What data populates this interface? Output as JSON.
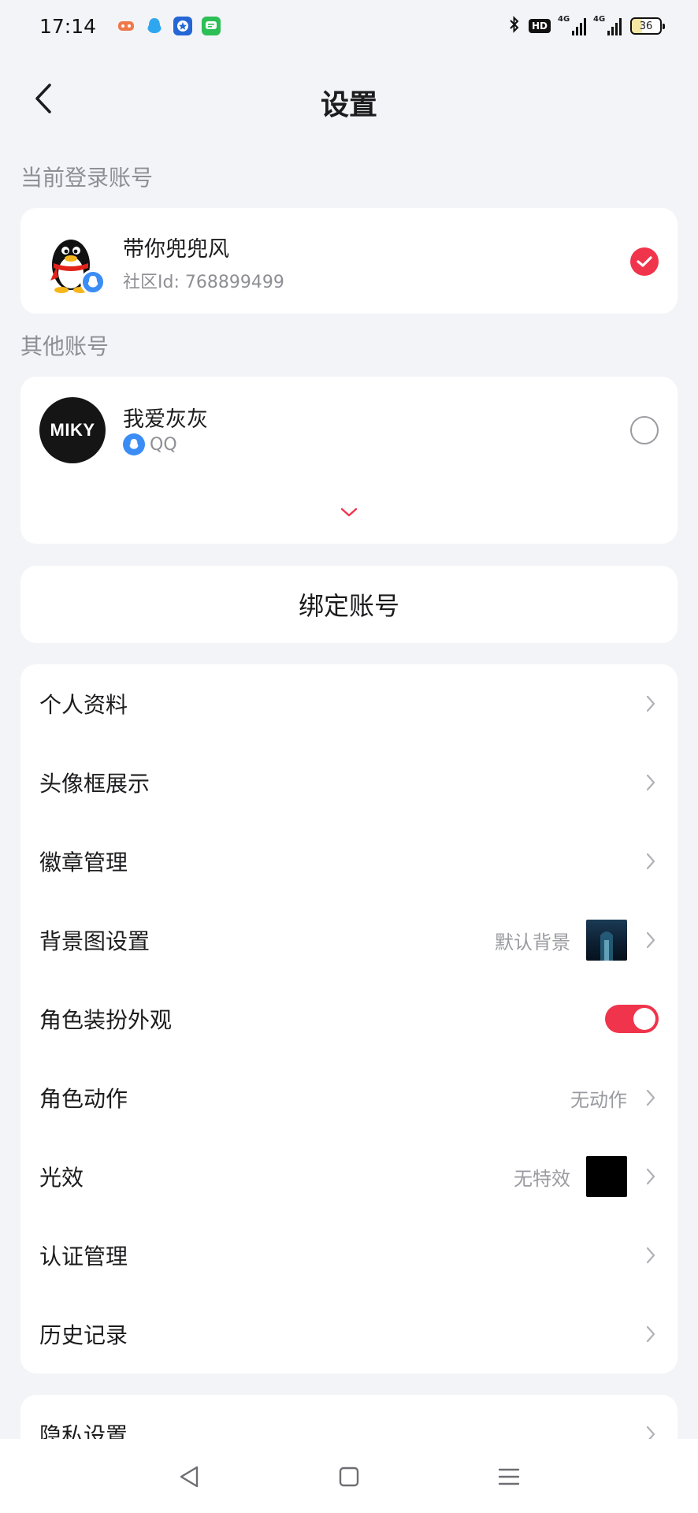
{
  "status_bar": {
    "time": "17:14",
    "hd_label": "HD",
    "signal1_label": "4G",
    "signal2_label": "4G",
    "battery_level": "36",
    "notification_icons": [
      "game-app-icon",
      "qq-app-icon",
      "star-app-icon",
      "message-app-icon"
    ]
  },
  "header": {
    "title": "设置"
  },
  "current_account": {
    "section_label": "当前登录账号",
    "name": "带你兜兜风",
    "id_text": "社区Id: 768899499",
    "selected": true
  },
  "other_accounts": {
    "section_label": "其他账号",
    "items": [
      {
        "name": "我爱灰灰",
        "platform": "QQ",
        "avatar_text": "MIKY",
        "selected": false
      }
    ]
  },
  "bind_button": {
    "label": "绑定账号"
  },
  "menu": {
    "items": [
      {
        "label": "个人资料"
      },
      {
        "label": "头像框展示"
      },
      {
        "label": "徽章管理"
      },
      {
        "label": "背景图设置",
        "value": "默认背景"
      },
      {
        "label": "角色装扮外观",
        "toggle_on": true
      },
      {
        "label": "角色动作",
        "value": "无动作"
      },
      {
        "label": "光效",
        "value": "无特效"
      },
      {
        "label": "认证管理"
      },
      {
        "label": "历史记录"
      }
    ]
  },
  "menu2": {
    "items": [
      {
        "label": "隐私设置"
      }
    ]
  },
  "colors": {
    "accent": "#f0344c",
    "background": "#f3f4f8",
    "card": "#ffffff",
    "secondary_text": "#8e8f94"
  }
}
